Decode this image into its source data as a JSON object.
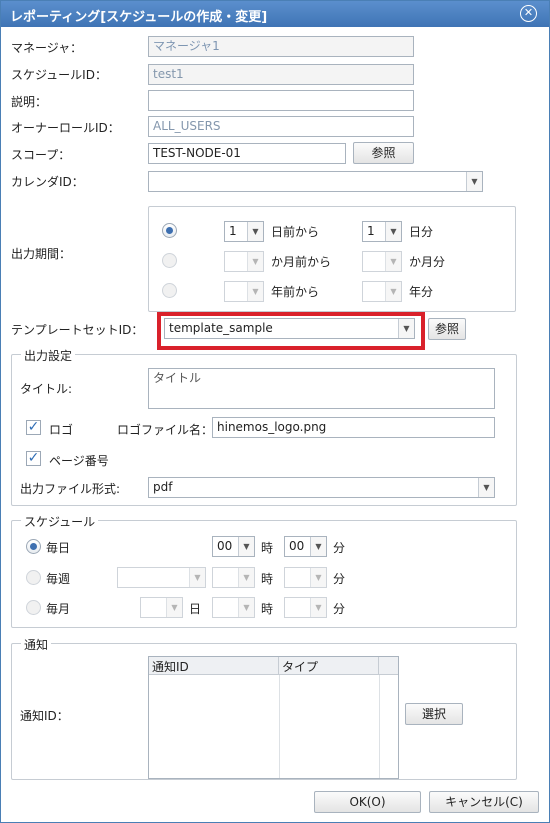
{
  "window": {
    "title": "レポーティング[スケジュールの作成・変更]",
    "close_glyph": "✕"
  },
  "form": {
    "manager": {
      "label": "マネージャ：",
      "value": "マネージャ1"
    },
    "schedule_id": {
      "label": "スケジュールID：",
      "value": "test1"
    },
    "description": {
      "label": "説明：",
      "value": ""
    },
    "owner_role": {
      "label": "オーナーロールID：",
      "value": "ALL_USERS"
    },
    "scope": {
      "label": "スコープ：",
      "value": "TEST-NODE-01",
      "browse": "参照"
    },
    "calendar": {
      "label": "カレンダID：",
      "value": ""
    }
  },
  "period": {
    "label": "出力期間：",
    "rows": [
      {
        "value": "1",
        "text1": "日前から",
        "value2": "1",
        "text2": "日分",
        "selected": true
      },
      {
        "value": "",
        "text1": "か月前から",
        "value2": "",
        "text2": "か月分",
        "selected": false
      },
      {
        "value": "",
        "text1": "年前から",
        "value2": "",
        "text2": "年分",
        "selected": false
      }
    ]
  },
  "template": {
    "label": "テンプレートセットID：",
    "value": "template_sample",
    "browse": "参照"
  },
  "output": {
    "legend": "出力設定",
    "title_label": "タイトル:",
    "title_value": "タイトル",
    "logo_label": "ロゴ",
    "logo_checked": true,
    "logo_file_label": "ロゴファイル名：",
    "logo_file_value": "hinemos_logo.png",
    "page_number_label": "ページ番号",
    "page_number_checked": true,
    "format_label": "出力ファイル形式:",
    "format_value": "pdf"
  },
  "schedule": {
    "legend": "スケジュール",
    "daily": {
      "label": "毎日",
      "hour": "00",
      "hour_unit": "時",
      "minute": "00",
      "minute_unit": "分",
      "selected": true
    },
    "weekly": {
      "label": "毎週",
      "hour_unit": "時",
      "minute_unit": "分",
      "selected": false
    },
    "monthly": {
      "label": "毎月",
      "day_unit": "日",
      "hour_unit": "時",
      "minute_unit": "分",
      "selected": false
    }
  },
  "notify": {
    "legend": "通知",
    "label": "通知ID：",
    "columns": [
      "通知ID",
      "タイプ"
    ],
    "select_button": "選択"
  },
  "buttons": {
    "ok": "OK(O)",
    "cancel": "キャンセル(C)"
  },
  "colors": {
    "titlebar": "#4a80c2",
    "highlight": "#d9212b",
    "accent": "#3d6fb0"
  }
}
